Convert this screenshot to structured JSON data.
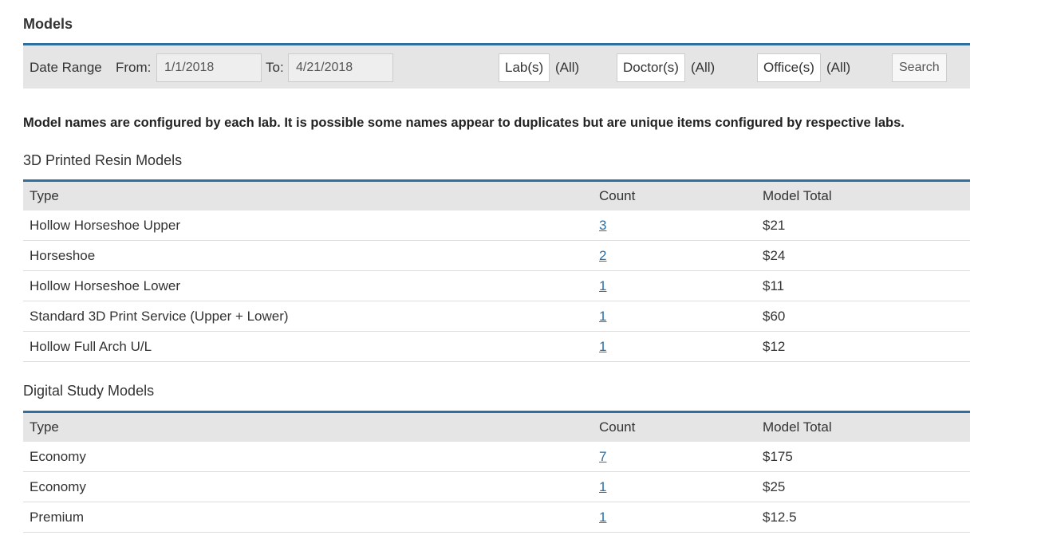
{
  "page": {
    "title": "Models"
  },
  "filters": {
    "date_range_label": "Date Range",
    "from_label": "From:",
    "from_value": "1/1/2018",
    "to_label": "To:",
    "to_value": "4/21/2018",
    "labs_button": "Lab(s)",
    "labs_value": "(All)",
    "doctors_button": "Doctor(s)",
    "doctors_value": "(All)",
    "offices_button": "Office(s)",
    "offices_value": "(All)",
    "search_button": "Search"
  },
  "notice": "Model names are configured by each lab. It is possible some names appear to duplicates but are unique items configured by respective labs.",
  "sections": [
    {
      "title": "3D Printed Resin Models",
      "headers": {
        "type": "Type",
        "count": "Count",
        "total": "Model Total"
      },
      "rows": [
        {
          "type": "Hollow Horseshoe Upper",
          "count": "3",
          "total": "$21"
        },
        {
          "type": "Horseshoe",
          "count": "2",
          "total": "$24"
        },
        {
          "type": "Hollow Horseshoe Lower",
          "count": "1",
          "total": "$11"
        },
        {
          "type": "Standard 3D Print Service (Upper + Lower)",
          "count": "1",
          "total": "$60"
        },
        {
          "type": "Hollow Full Arch U/L",
          "count": "1",
          "total": "$12"
        }
      ]
    },
    {
      "title": "Digital Study Models",
      "headers": {
        "type": "Type",
        "count": "Count",
        "total": "Model Total"
      },
      "rows": [
        {
          "type": "Economy",
          "count": "7",
          "total": "$175"
        },
        {
          "type": "Economy",
          "count": "1",
          "total": "$25"
        },
        {
          "type": "Premium",
          "count": "1",
          "total": "$12.5"
        }
      ]
    }
  ]
}
